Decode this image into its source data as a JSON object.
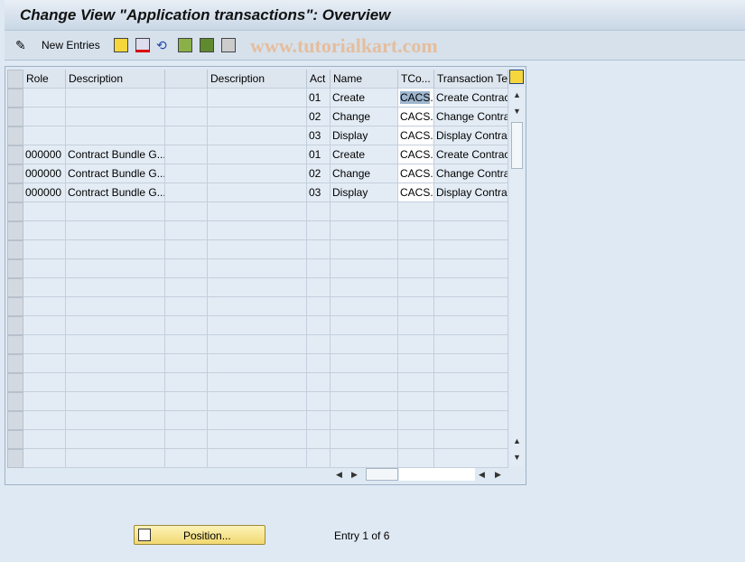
{
  "title": "Change View \"Application transactions\": Overview",
  "toolbar": {
    "new_entries": "New Entries",
    "watermark": "www.tutorialkart.com",
    "icons": [
      "edit-glasses-icon",
      "copy-icon",
      "delete-icon",
      "undo-icon",
      "select-all-icon",
      "select-block-icon",
      "deselect-all-icon"
    ]
  },
  "table": {
    "headers": [
      "Role",
      "Description",
      "",
      "Description",
      "Act",
      "Name",
      "TCo...",
      "Transaction Te"
    ],
    "rows": [
      [
        "",
        "",
        "",
        "",
        "01",
        "Create",
        "CACS...",
        "Create Contrac"
      ],
      [
        "",
        "",
        "",
        "",
        "02",
        "Change",
        "CACS...",
        "Change Contra"
      ],
      [
        "",
        "",
        "",
        "",
        "03",
        "Display",
        "CACS...",
        "Display Contrac"
      ],
      [
        "000000",
        "Contract Bundle G...",
        "",
        "",
        "01",
        "Create",
        "CACS...",
        "Create Contrac"
      ],
      [
        "000000",
        "Contract Bundle G...",
        "",
        "",
        "02",
        "Change",
        "CACS...",
        "Change Contra"
      ],
      [
        "000000",
        "Contract Bundle G...",
        "",
        "",
        "03",
        "Display",
        "CACS...",
        "Display Contrac"
      ]
    ]
  },
  "footer": {
    "position_button": "Position...",
    "entry_info": "Entry 1 of 6"
  }
}
